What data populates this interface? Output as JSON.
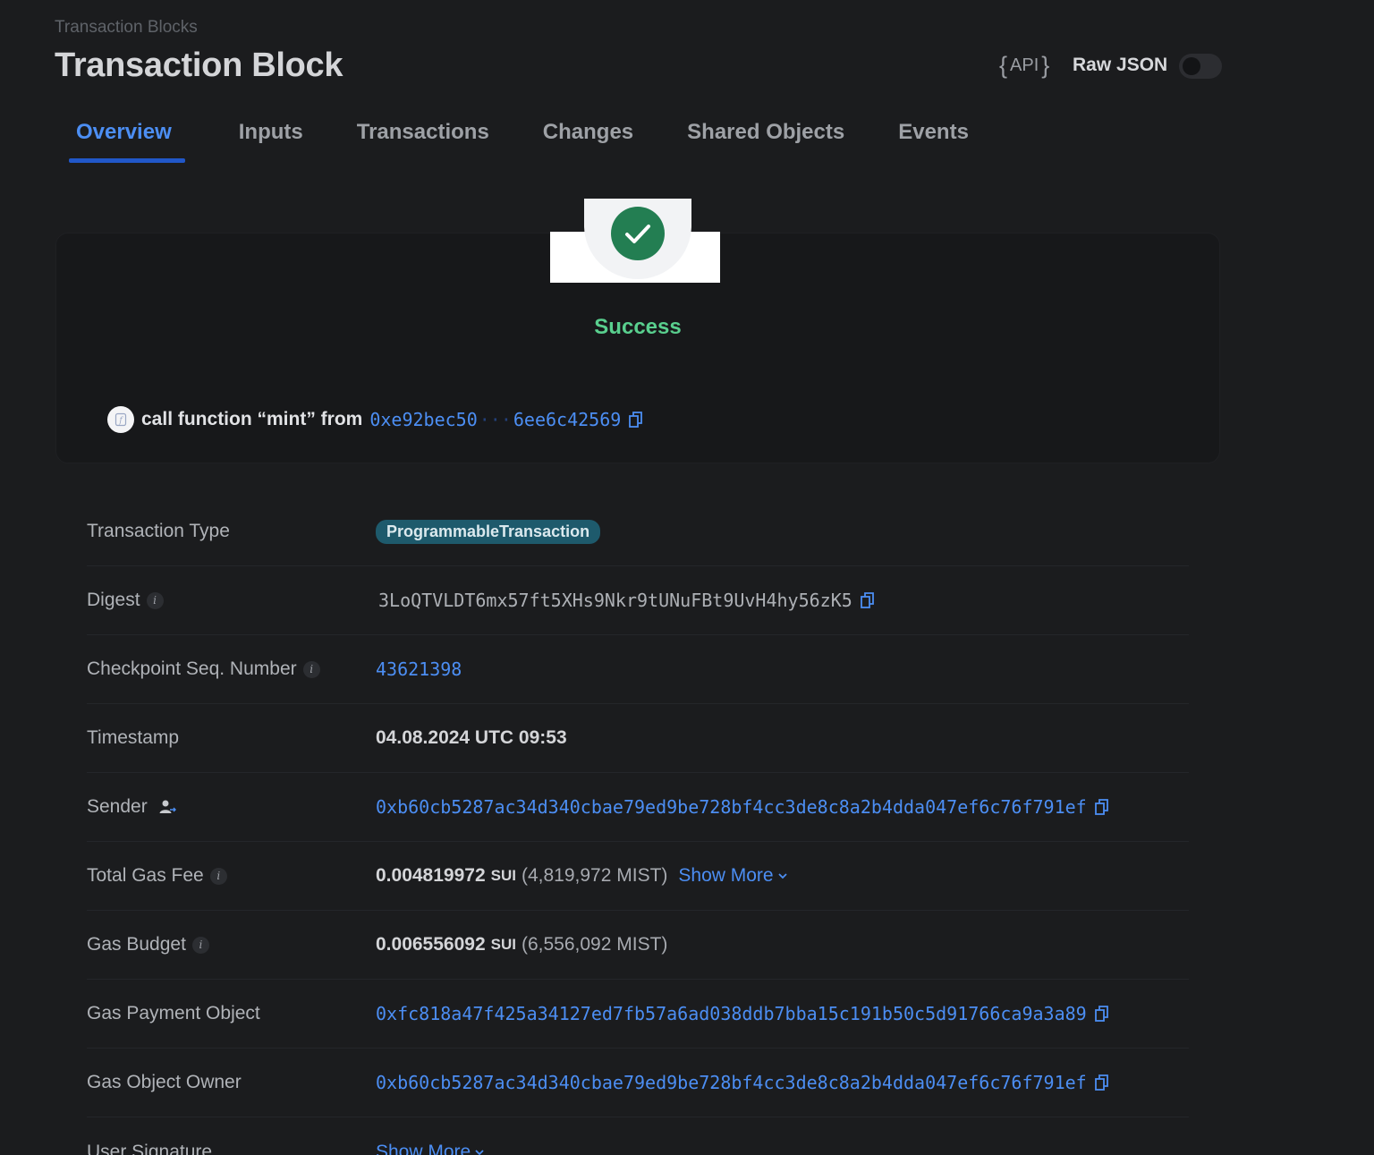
{
  "header": {
    "breadcrumb": "Transaction Blocks",
    "title": "Transaction Block",
    "api_label": "API",
    "raw_json_label": "Raw JSON",
    "raw_json_enabled": false
  },
  "tabs": [
    "Overview",
    "Inputs",
    "Transactions",
    "Changes",
    "Shared Objects",
    "Events"
  ],
  "active_tab": "Overview",
  "status": {
    "text": "Success",
    "icon": "check-icon",
    "color": "#237e52"
  },
  "call": {
    "prefix": "call function “mint” from",
    "address_start": "0xe92bec50",
    "ellipsis": "···",
    "address_end": "6ee6c42569"
  },
  "details": {
    "transaction_type": {
      "label": "Transaction Type",
      "value": "ProgrammableTransaction"
    },
    "digest": {
      "label": "Digest",
      "value": "3LoQTVLDT6mx57ft5XHs9Nkr9tUNuFBt9UvH4hy56zK5"
    },
    "checkpoint": {
      "label": "Checkpoint Seq. Number",
      "value": "43621398"
    },
    "timestamp": {
      "label": "Timestamp",
      "value": "04.08.2024 UTC 09:53"
    },
    "sender": {
      "label": "Sender",
      "value": "0xb60cb5287ac34d340cbae79ed9be728bf4cc3de8c8a2b4dda047ef6c76f791ef"
    },
    "total_gas_fee": {
      "label": "Total Gas Fee",
      "amount": "0.004819972",
      "unit": "SUI",
      "mist": "(4,819,972 MIST)",
      "show_more": "Show More"
    },
    "gas_budget": {
      "label": "Gas Budget",
      "amount": "0.006556092",
      "unit": "SUI",
      "mist": "(6,556,092 MIST)"
    },
    "gas_payment_object": {
      "label": "Gas Payment Object",
      "value": "0xfc818a47f425a34127ed7fb57a6ad038ddb7bba15c191b50c5d91766ca9a3a89"
    },
    "gas_object_owner": {
      "label": "Gas Object Owner",
      "value": "0xb60cb5287ac34d340cbae79ed9be728bf4cc3de8c8a2b4dda047ef6c76f791ef"
    },
    "user_signature": {
      "label": "User Signature",
      "show_more": "Show More"
    }
  },
  "colors": {
    "background": "#1b1c1e",
    "accent": "#4c8ef3",
    "success": "#59cf8e",
    "pill": "#1e5a6c"
  }
}
